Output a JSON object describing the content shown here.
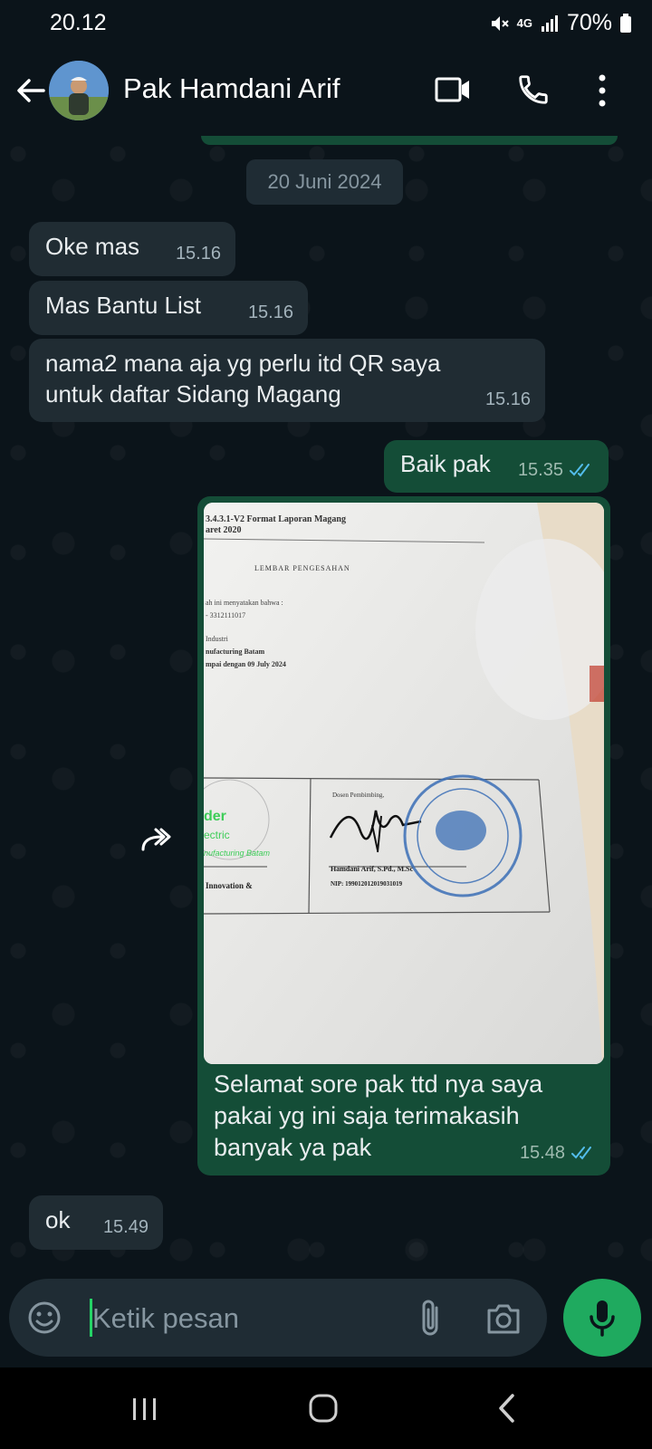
{
  "status": {
    "time": "20.12",
    "network": "4G",
    "battery": "70%"
  },
  "header": {
    "contact_name": "Pak Hamdani Arif"
  },
  "date_chip": "20 Juni 2024",
  "messages": [
    {
      "type": "incoming",
      "lines": [
        "Oke mas"
      ],
      "time": "15.16"
    },
    {
      "type": "incoming",
      "lines": [
        "Mas Bantu List"
      ],
      "time": "15.16"
    },
    {
      "type": "incoming",
      "lines": [
        "nama2 mana aja yg perlu itd QR saya",
        "untuk daftar Sidang Magang"
      ],
      "time": "15.16"
    },
    {
      "type": "outgoing",
      "lines": [
        "Baik pak"
      ],
      "time": "15.35",
      "read": true
    },
    {
      "type": "outgoing-image",
      "caption_lines": [
        "Selamat sore pak ttd nya saya",
        "pakai yg ini saja terimakasih",
        "banyak ya pak"
      ],
      "time": "15.48",
      "read": true
    },
    {
      "type": "incoming",
      "lines": [
        "ok"
      ],
      "time": "15.49"
    }
  ],
  "photo_text": {
    "doc_title": "3.4.3.1-V2 Format Laporan Magang",
    "doc_date": "aret 2020",
    "sheet_title": "LEMBAR PENGESAHAN",
    "line1": "ah ini menyatakan bahwa :",
    "line2": "- 3312111017",
    "line3": "Industri",
    "line4": "nufacturing Batam",
    "line5": "mpai dengan 09 July 2024",
    "logo1": "der",
    "logo2": "ectric",
    "logo3": "nufacturing Batam",
    "innovation": "Innovation &",
    "supervisor_label": "Dosen Pembimbing,",
    "supervisor_name": "Hamdani Arif, S.Pd., M.Sc",
    "nip": "NIP: 199012012019031019"
  },
  "input": {
    "placeholder": "Ketik pesan"
  },
  "colors": {
    "incoming": "#202c33",
    "outgoing": "#144d37",
    "accent": "#25d366",
    "read_ticks": "#53bdeb"
  }
}
